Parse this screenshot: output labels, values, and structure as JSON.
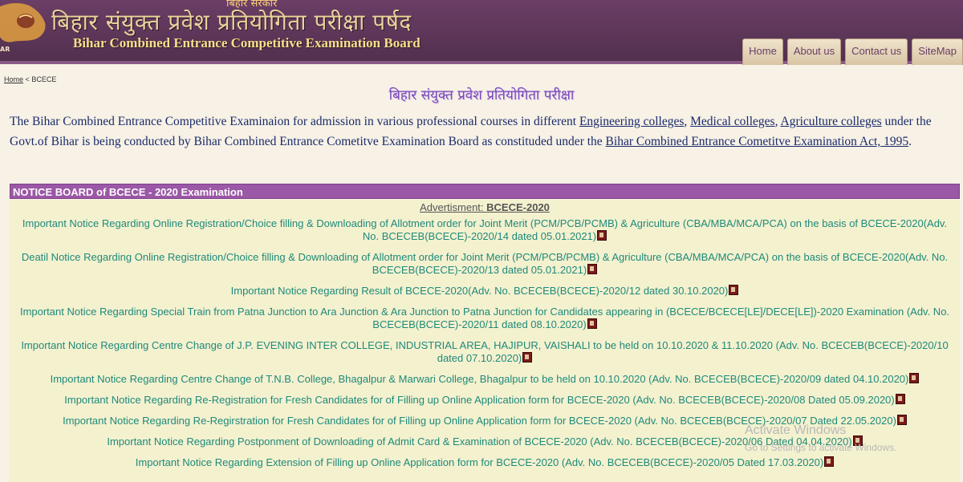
{
  "header": {
    "govt_tag": "बिहार सरकार",
    "hindi_title": "बिहार संयुक्त प्रवेश प्रतियोगिता परीक्षा पर्षद",
    "english_title": "Bihar Combined Entrance Competitive Examination Board",
    "logo_text": "AR"
  },
  "nav": [
    "Home",
    "About us",
    "Contact us",
    "SiteMap"
  ],
  "breadcrumb": {
    "home": "Home",
    "sep": "<",
    "current": "BCECE"
  },
  "subtitle_hindi": "बिहार संयुक्त प्रवेश प्रतियोगिता परीक्षा",
  "intro": {
    "part1": "The Bihar Combined Entrance Competitive Examinaion for admission in various professional courses in different ",
    "link_eng": "Engineering colleges",
    "sep1": ", ",
    "link_med": "Medical colleges",
    "sep2": ", ",
    "link_agri": "Agriculture colleges",
    "part2": " under the Govt.of  Bihar is being conducted by Bihar Combined Entrance Cometitve Examination Board as constituded under the ",
    "link_act": "Bihar Combined Entrance Cometitve Examination Act, 1995",
    "part3": "."
  },
  "notice_board": {
    "title": "NOTICE BOARD of BCECE - 2020 Examination",
    "adv_label": "Advertisment: ",
    "adv_link": "BCECE-2020",
    "notices": [
      "Important Notice Regarding Online Registration/Choice filling & Downloading of Allotment order for Joint Merit (PCM/PCB/PCMB) & Agriculture (CBA/MBA/MCA/PCA) on the basis of BCECE-2020(Adv. No. BCECEB(BCECE)-2020/14 dated 05.01.2021)",
      "Deatil Notice Regarding Online Registration/Choice filling & Downloading of Allotment order for Joint Merit (PCM/PCB/PCMB) & Agriculture (CBA/MBA/MCA/PCA) on the basis of BCECE-2020(Adv. No. BCECEB(BCECE)-2020/13 dated 05.01.2021)",
      "Important Notice Regarding Result of BCECE-2020(Adv. No. BCECEB(BCECE)-2020/12 dated 30.10.2020)",
      "Important Notice Regarding Special Train from Patna Junction to Ara Junction & Ara Junction to Patna Junction for Candidates appearing in (BCECE/BCECE[LE]/DECE[LE])-2020 Examination (Adv. No. BCECEB(BCECE)-2020/11 dated 08.10.2020)",
      "Important Notice Regarding Centre Change of J.P. EVENING INTER COLLEGE, INDUSTRIAL AREA, HAJIPUR, VAISHALI to be held on 10.10.2020 & 11.10.2020 (Adv. No. BCECEB(BCECE)-2020/10 dated 07.10.2020)",
      "Important Notice Regarding Centre Change of T.N.B. College, Bhagalpur & Marwari College, Bhagalpur to be held on 10.10.2020 (Adv. No. BCECEB(BCECE)-2020/09 dated 04.10.2020)",
      "Important Notice Regarding Re-Registration for Fresh Candidates for of Filling up Online Application form for BCECE-2020 (Adv. No. BCECEB(BCECE)-2020/08 Dated 05.09.2020)",
      "Important Notice Regarding Re-Regirstration for Fresh Candidates for of Filling up Online Application form for BCECE-2020 (Adv. No. BCECEB(BCECE)-2020/07 Dated 22.05.2020)",
      "Important Notice Regarding Postponment of Downloading of Admit Card & Examination of BCECE-2020 (Adv. No. BCECEB(BCECE)-2020/06 Dated 04.04.2020)",
      "Important Notice Regarding Extension of Filling up Online Application form for BCECE-2020 (Adv. No. BCECEB(BCECE)-2020/05 Dated 17.03.2020)"
    ]
  },
  "watermark": {
    "line1": "Activate Windows",
    "line2": "Go to Settings to activate Windows."
  },
  "colors": {
    "header_bg": "#5c3457",
    "notice_header": "#9b58a6",
    "notice_bg": "#f4f1cf",
    "notice_text": "#1e8a7a",
    "intro_text": "#1a2a6a"
  }
}
